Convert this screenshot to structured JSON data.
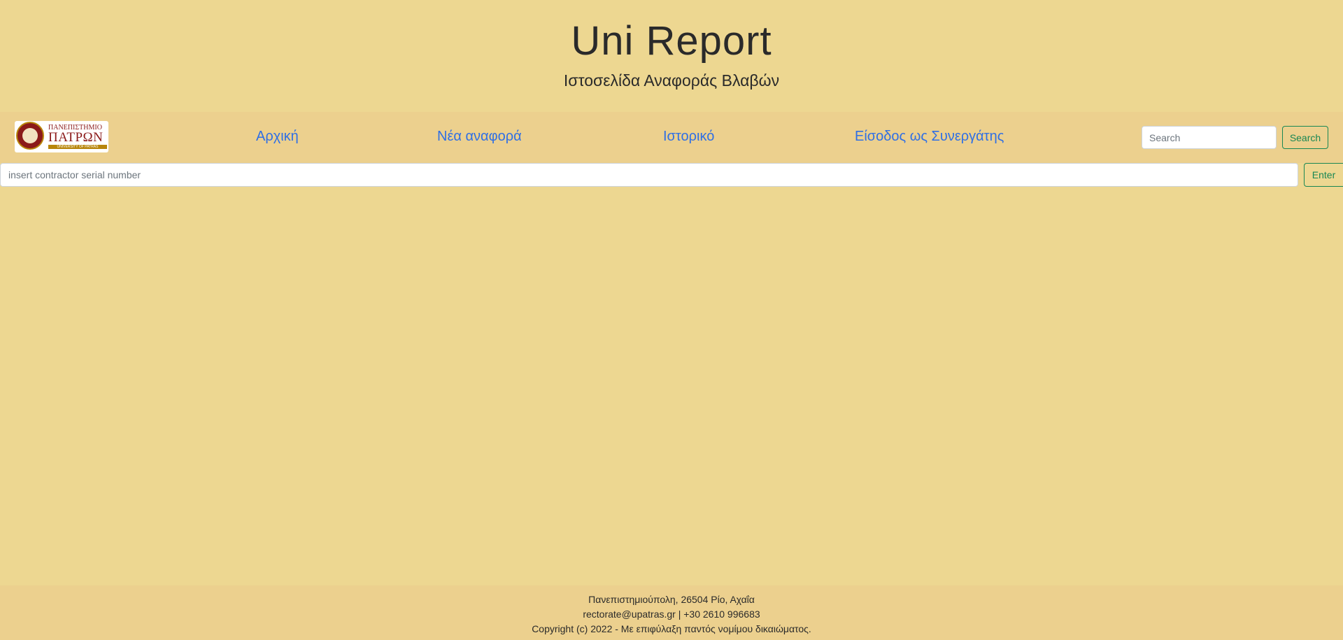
{
  "header": {
    "title": "Uni Report",
    "subtitle": "Ιστοσελίδα Αναφοράς Βλαβών"
  },
  "navbar": {
    "logo": {
      "line1": "ΠΑΝΕΠΙΣΤΗΜΙΟ",
      "line2": "ΠΑΤΡΩΝ",
      "line3": "UNIVERSITY OF PATRAS"
    },
    "links": {
      "home": "Αρχική",
      "new_report": "Νέα αναφορά",
      "history": "Ιστορικό",
      "partner_login": "Είσοδος ως Συνεργάτης"
    },
    "search": {
      "placeholder": "Search",
      "button_label": "Search"
    }
  },
  "contractor": {
    "placeholder": "insert contractor serial number",
    "button_label": "Enter"
  },
  "footer": {
    "address": "Πανεπιστημιούπολη, 26504 Ρίο, Αχαΐα",
    "contact": "rectorate@upatras.gr | +30 2610 996683",
    "copyright": "Copyright (c) 2022 - Με επιφύλαξη παντός νομίμου δικαιώματος."
  },
  "colors": {
    "page_background": "#edd791",
    "bar_background": "#ecd08e",
    "link": "#2f6fe5",
    "button_outline": "#198754"
  }
}
